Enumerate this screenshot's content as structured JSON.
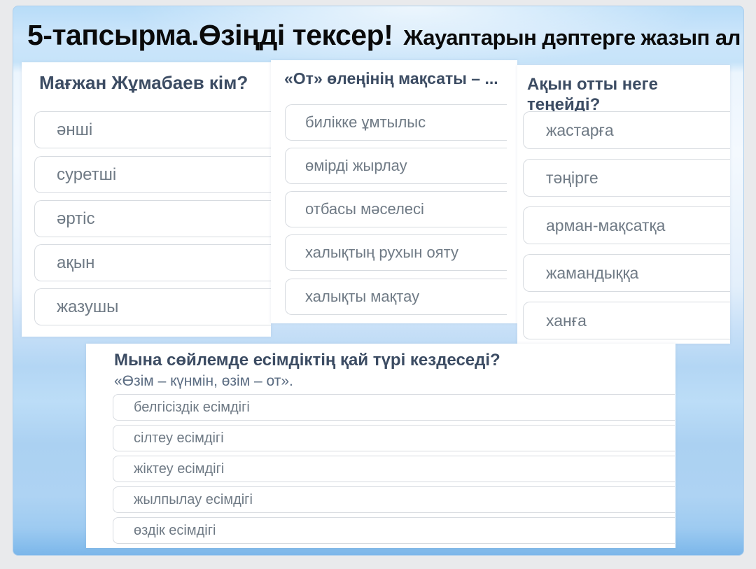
{
  "slide": {
    "title_main": "5-тапсырма.Өзіңді тексер!",
    "title_sub": "Жауаптарын дәптерге жазып ал"
  },
  "quizzes": [
    {
      "question": "Мағжан Жұмабаев кім?",
      "options": [
        "әнші",
        "суретші",
        "әртіс",
        "ақын",
        "жазушы"
      ]
    },
    {
      "question": "«От» өлеңінің мақсаты – ...",
      "options": [
        "билікке ұмтылыс",
        "өмірді жырлау",
        "отбасы мәселесі",
        "халықтың рухын ояту",
        "халықты мақтау"
      ]
    },
    {
      "question": "Ақын отты неге теңейді?",
      "options": [
        "жастарға",
        "тәңірге",
        "арман-мақсатқа",
        "жамандыққа",
        "ханға"
      ]
    },
    {
      "question": "Мына сөйлемде есімдіктің қай түрі кездеседі?",
      "subtitle": "«Өзім – күнмін, өзім – от».",
      "options": [
        "белгісіздік есімдігі",
        "сілтеу есімдігі",
        "жіктеу есімдігі",
        "жылпылау есімдігі",
        "өздік есімдігі"
      ]
    }
  ],
  "colors": {
    "question_text": "#3c4c63",
    "option_text": "#6f7a85",
    "option_border": "#d7dbe0",
    "panel_background": "#ffffff",
    "slide_blue_top": "#b7dcf8",
    "slide_blue_bottom": "#7ab5e9",
    "outer_background": "#e9eaec",
    "title_text": "#0a0a0a"
  }
}
